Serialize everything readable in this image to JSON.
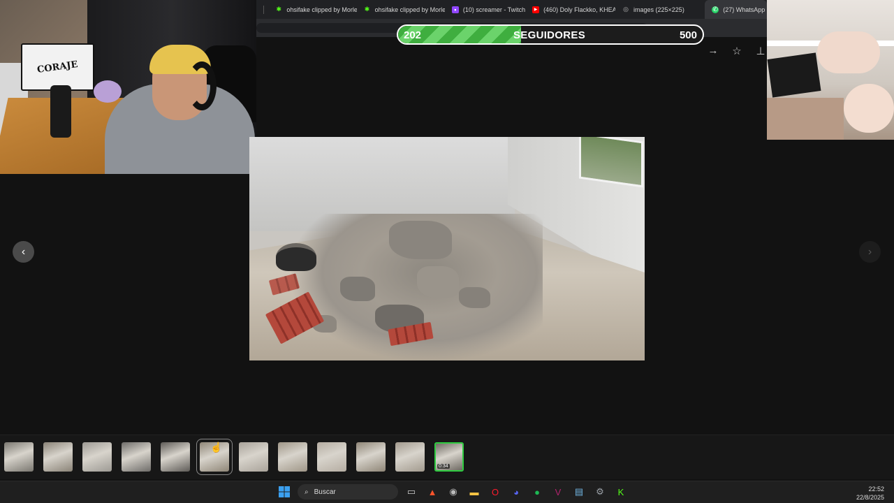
{
  "browser": {
    "tabs": [
      {
        "label": "ohsifake clipped by Morle",
        "icon": "kick-icon",
        "color": "#53fc18"
      },
      {
        "label": "ohsifake clipped by Morle",
        "icon": "kick-icon",
        "color": "#53fc18"
      },
      {
        "label": "(10) screamer - Twitch",
        "icon": "twitch-icon",
        "color": "#9146ff"
      },
      {
        "label": "(460) Doly Flackko, KHEA",
        "icon": "youtube-icon",
        "color": "#ff0000"
      },
      {
        "label": "images (225×225)",
        "icon": "globe-icon",
        "color": "#bbbbbb"
      },
      {
        "label": "(27) WhatsApp",
        "icon": "whatsapp-icon",
        "color": "#25d366"
      }
    ]
  },
  "overlay": {
    "webcam_poster_text": "CORAJE",
    "goal": {
      "current": "202",
      "label": "SEGUIDORES",
      "target": "500",
      "current_value": 202,
      "target_value": 500
    }
  },
  "viewer": {
    "tools": [
      {
        "name": "forward-icon",
        "glyph": "→"
      },
      {
        "name": "star-icon",
        "glyph": "☆"
      },
      {
        "name": "pin-icon",
        "glyph": "⊥"
      }
    ],
    "prev_glyph": "‹",
    "next_glyph": "›"
  },
  "thumbnails": [
    {
      "tone": "#7a7770"
    },
    {
      "tone": "#8a8377"
    },
    {
      "tone": "#9d9a94"
    },
    {
      "tone": "#6e6c69"
    },
    {
      "tone": "#5e5b57"
    },
    {
      "tone": "#8f8677",
      "selected": true
    },
    {
      "tone": "#a9a39a"
    },
    {
      "tone": "#9f9687"
    },
    {
      "tone": "#b5ada2"
    },
    {
      "tone": "#8f8677"
    },
    {
      "tone": "#a29a8e"
    },
    {
      "tone": "#6f6a63",
      "current": true,
      "badge": "0:34"
    }
  ],
  "taskbar": {
    "search_placeholder": "Buscar",
    "time": "22:52",
    "date": "22/8/2025",
    "apps": [
      {
        "name": "task-view-icon",
        "glyph": "▭",
        "color": "#cccccc"
      },
      {
        "name": "brave-icon",
        "glyph": "▲",
        "color": "#fb542b"
      },
      {
        "name": "chrome-icon",
        "glyph": "◉",
        "color": "#bbbbbb"
      },
      {
        "name": "file-explorer-icon",
        "glyph": "▬",
        "color": "#f6c444"
      },
      {
        "name": "opera-icon",
        "glyph": "O",
        "color": "#ff1b2d"
      },
      {
        "name": "discord-icon",
        "glyph": "◕",
        "color": "#5865f2"
      },
      {
        "name": "spotify-icon",
        "glyph": "●",
        "color": "#1db954"
      },
      {
        "name": "vegas-icon",
        "glyph": "V",
        "color": "#b1236d"
      },
      {
        "name": "notepad-icon",
        "glyph": "▤",
        "color": "#6fb3e0"
      },
      {
        "name": "settings-icon",
        "glyph": "⚙",
        "color": "#9aa0a6"
      },
      {
        "name": "kick-icon",
        "glyph": "K",
        "color": "#53fc18"
      }
    ]
  }
}
